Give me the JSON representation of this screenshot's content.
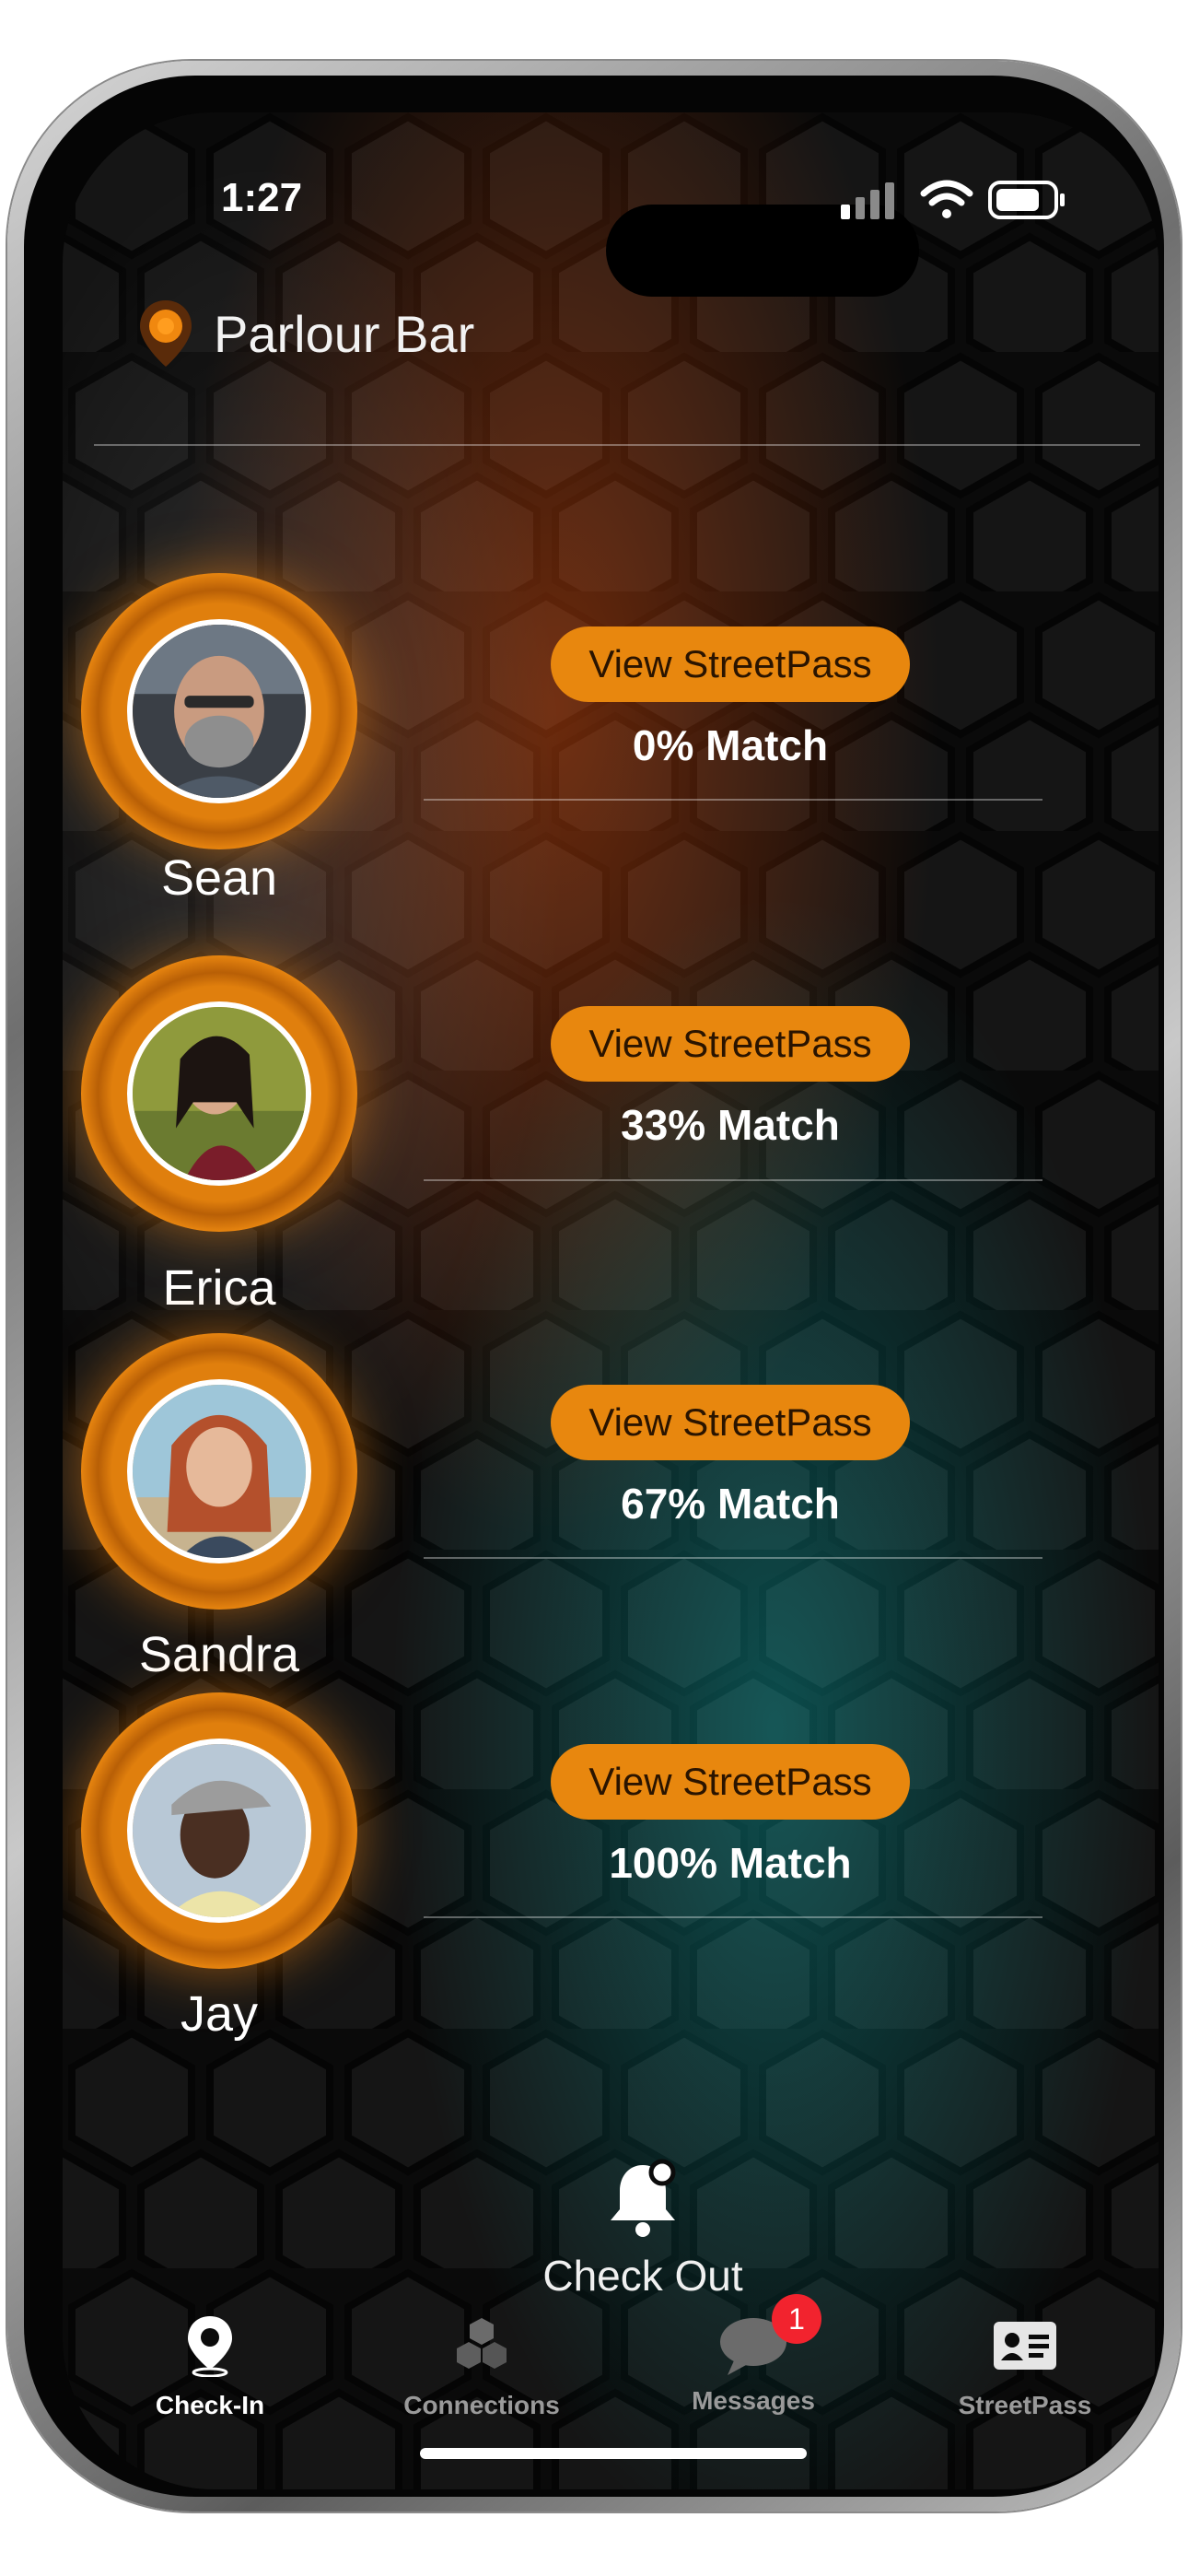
{
  "status": {
    "time": "1:27"
  },
  "venue": {
    "name": "Parlour Bar",
    "icon": "location-pin-icon"
  },
  "people": [
    {
      "name": "Sean",
      "button_label": "View StreetPass",
      "match": "0% Match"
    },
    {
      "name": "Erica",
      "button_label": "View StreetPass",
      "match": "33% Match"
    },
    {
      "name": "Sandra",
      "button_label": "View StreetPass",
      "match": "67% Match"
    },
    {
      "name": "Jay",
      "button_label": "View StreetPass",
      "match": "100% Match"
    }
  ],
  "checkout": {
    "label": "Check Out",
    "icon": "bell-icon"
  },
  "tabs": [
    {
      "label": "Check-In",
      "icon": "map-pin-icon",
      "active": true
    },
    {
      "label": "Connections",
      "icon": "hexagons-icon",
      "active": false
    },
    {
      "label": "Messages",
      "icon": "chat-bubble-icon",
      "active": false,
      "badge": "1"
    },
    {
      "label": "StreetPass",
      "icon": "id-card-icon",
      "active": false
    }
  ],
  "colors": {
    "accent": "#e8870e",
    "badge": "#f2232e",
    "background": "#0b0b0b"
  }
}
